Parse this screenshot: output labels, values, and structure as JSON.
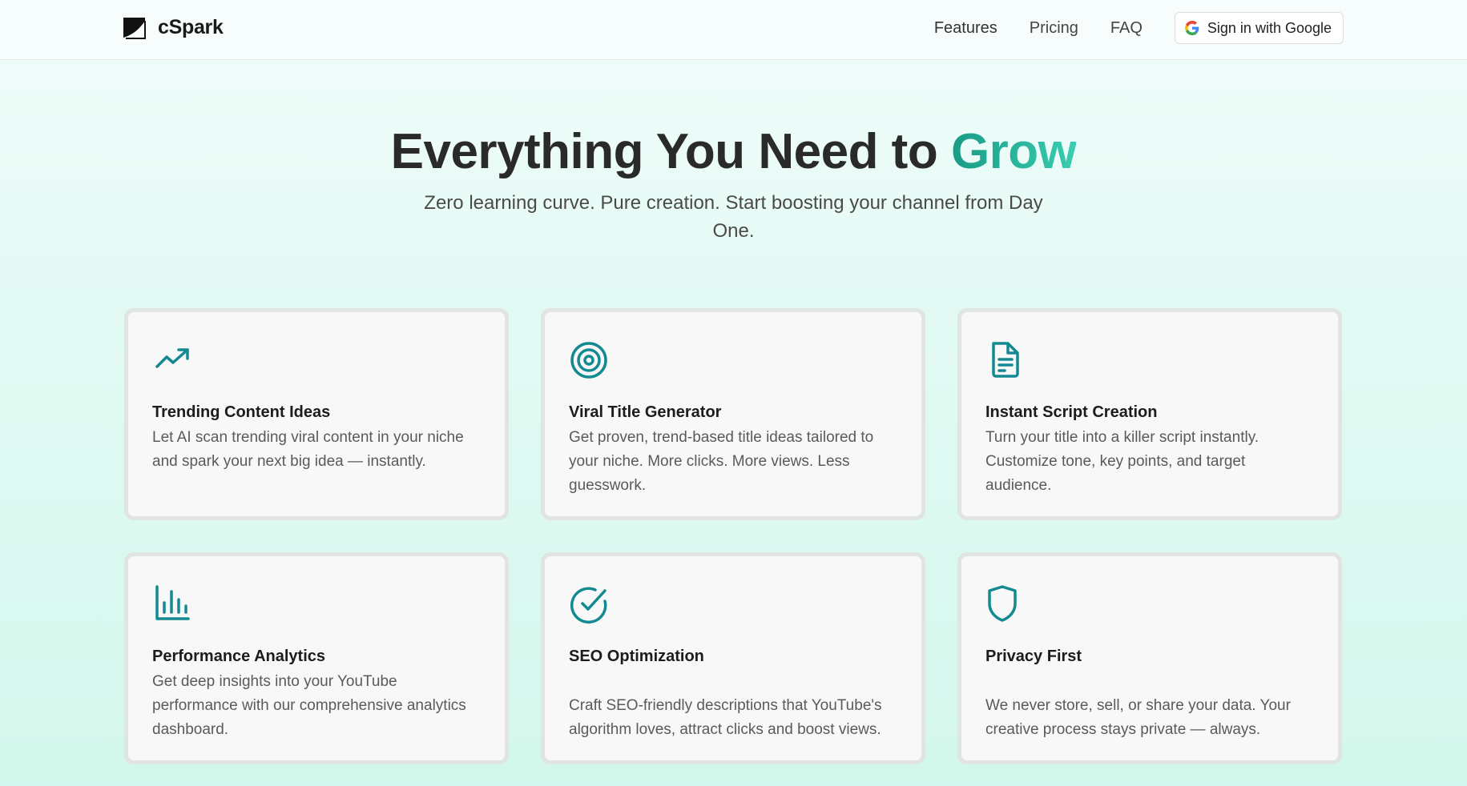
{
  "header": {
    "brand": "cSpark",
    "nav": [
      "Features",
      "Pricing",
      "FAQ"
    ],
    "signin_label": "Sign in with Google"
  },
  "hero": {
    "title_prefix": "Everything You Need to ",
    "title_accent": "Grow",
    "subtitle": "Zero learning curve. Pure creation. Start boosting your channel from Day One."
  },
  "features": [
    {
      "icon": "trending-up-icon",
      "title": "Trending Content Ideas",
      "desc": "Let AI scan trending viral content in your niche and spark your next big idea — instantly."
    },
    {
      "icon": "target-icon",
      "title": "Viral Title Generator",
      "desc": "Get proven, trend-based title ideas tailored to your niche. More clicks. More views. Less guesswork."
    },
    {
      "icon": "document-icon",
      "title": "Instant Script Creation",
      "desc": "Turn your title into a killer script instantly. Customize tone, key points, and target audience."
    },
    {
      "icon": "bar-chart-icon",
      "title": "Performance Analytics",
      "desc": "Get deep insights into your YouTube performance with our comprehensive analytics dashboard."
    },
    {
      "icon": "check-circle-icon",
      "title": "SEO Optimization",
      "desc": "Craft SEO-friendly descriptions that YouTube's algorithm loves, attract clicks and boost views."
    },
    {
      "icon": "shield-icon",
      "title": "Privacy First",
      "desc": "We never store, sell, or share your data. Your creative process stays private — always."
    }
  ],
  "colors": {
    "accent": "#138a91",
    "accent_gradient_start": "#1a9b86",
    "accent_gradient_end": "#39cdb1",
    "card_bg": "#f8f8f8",
    "card_border": "#e0e4e3"
  }
}
